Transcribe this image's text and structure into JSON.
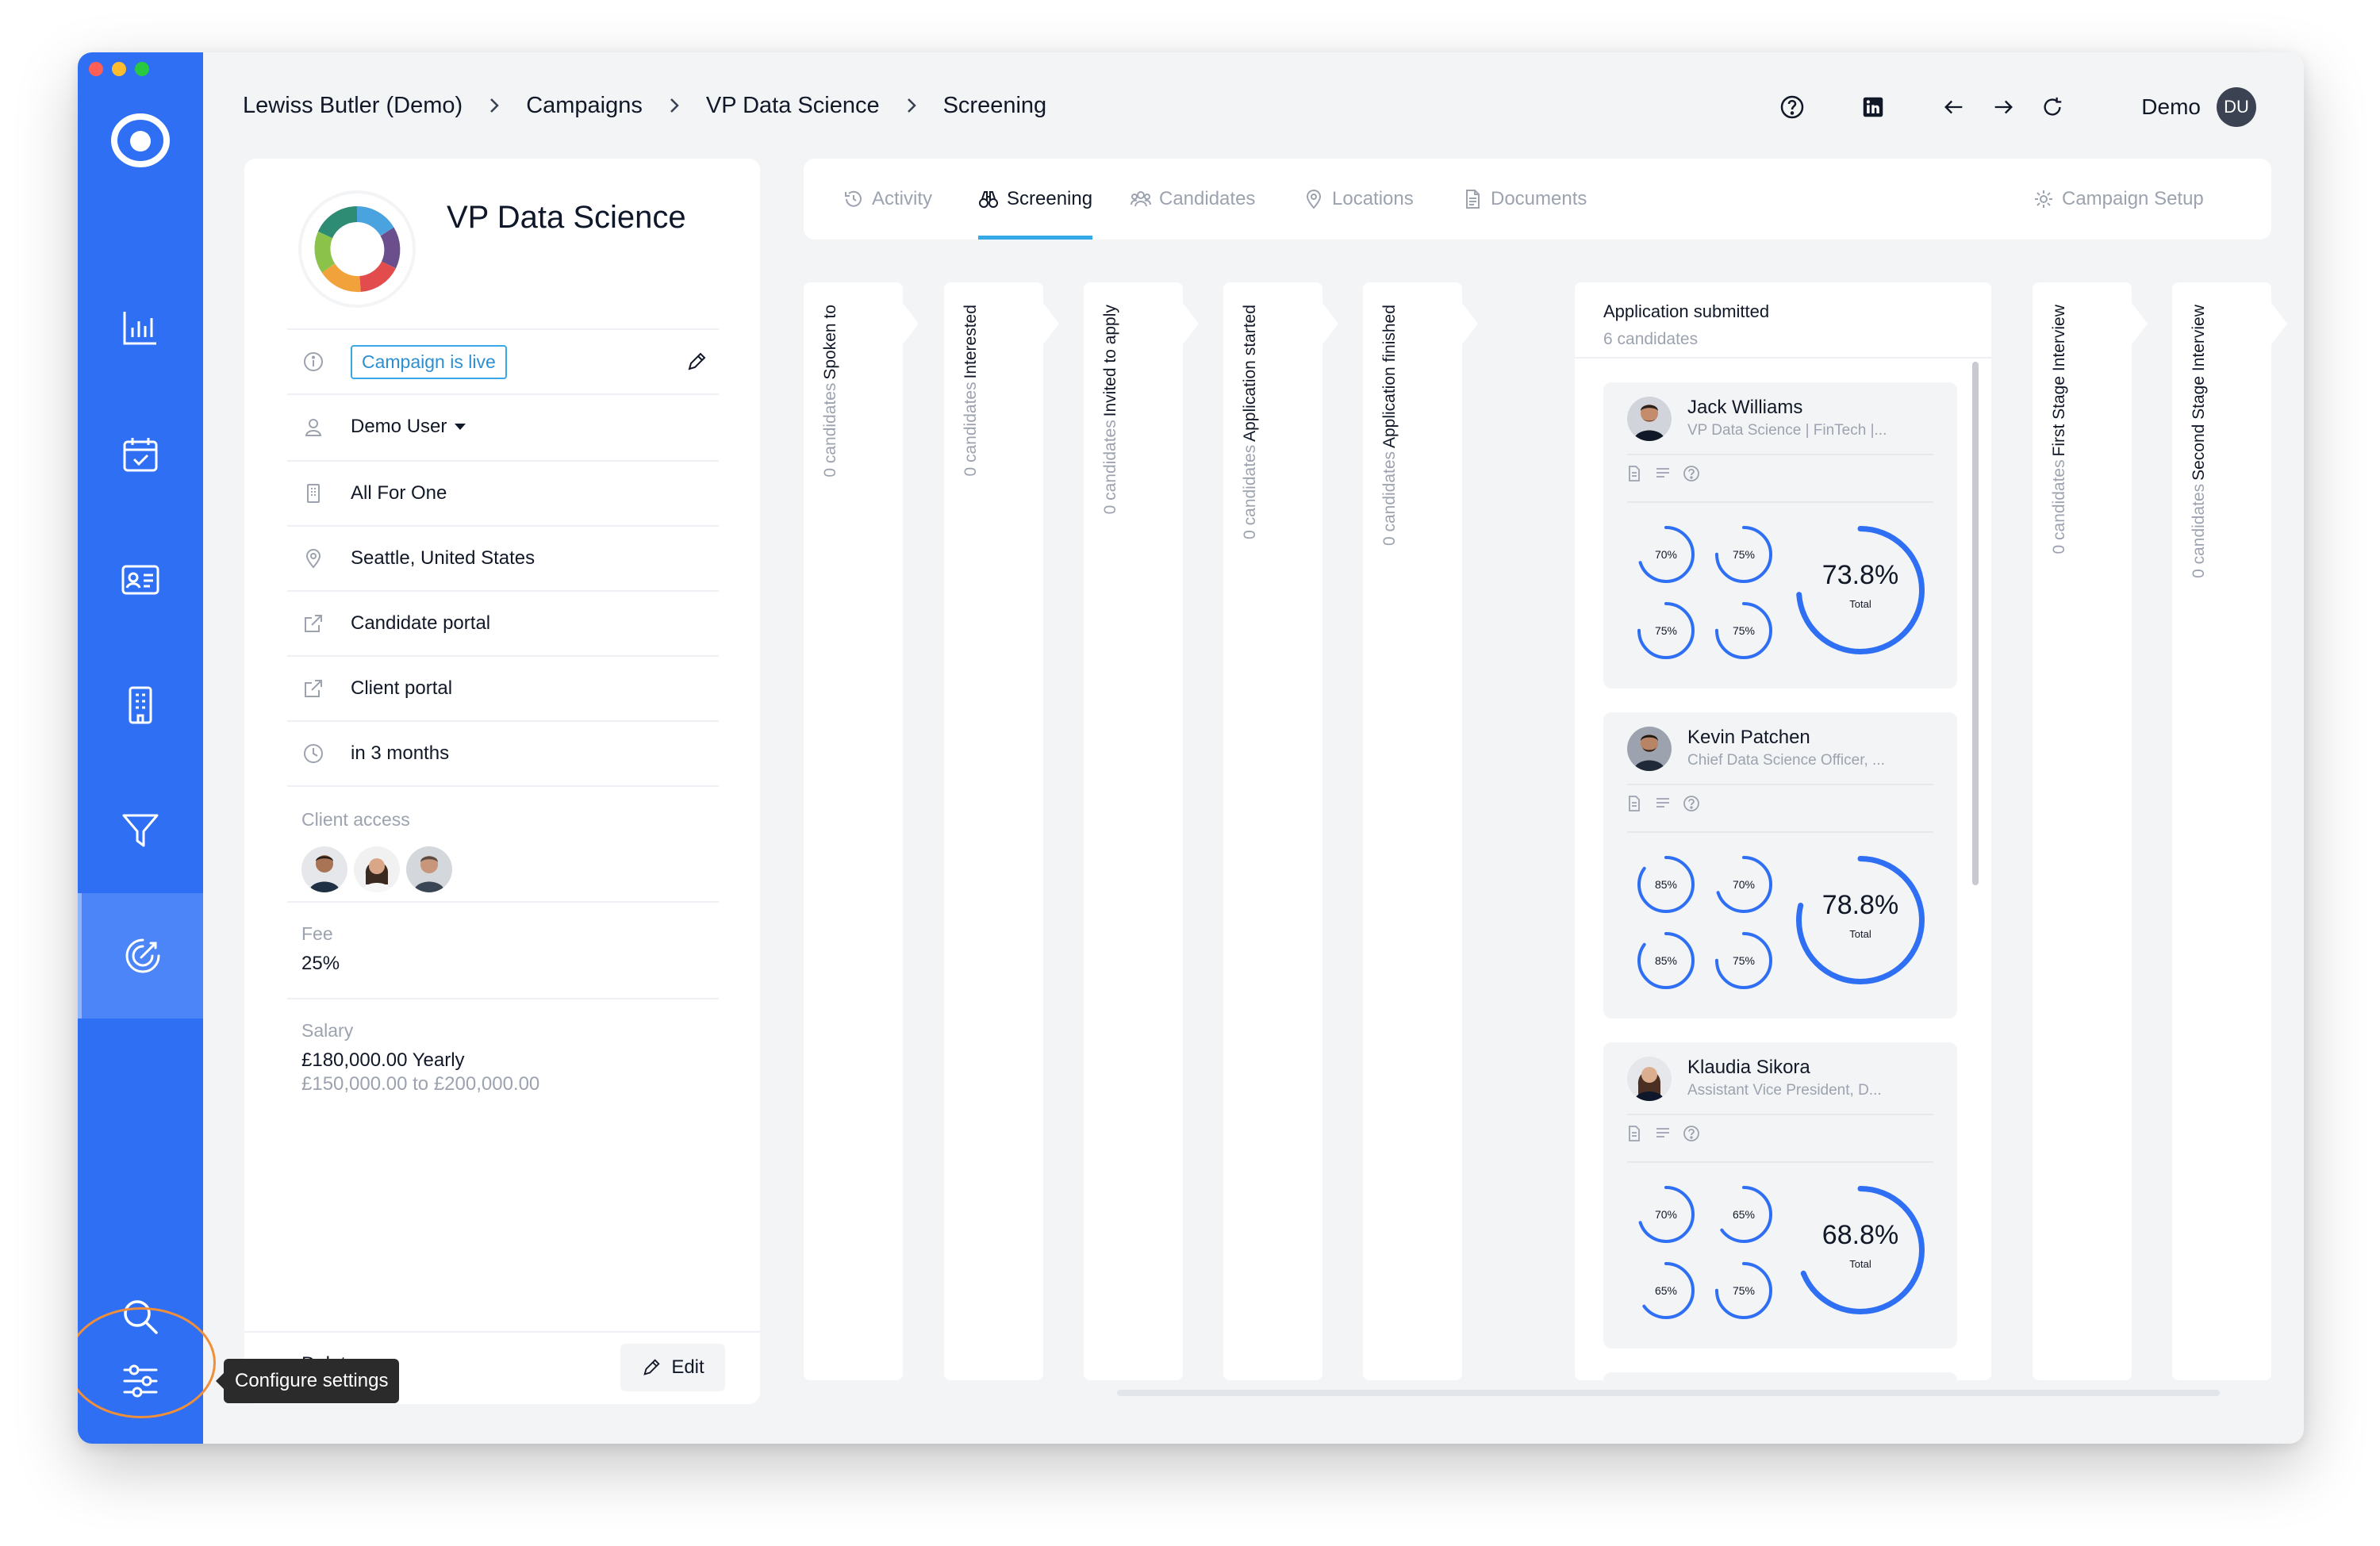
{
  "breadcrumb": [
    "Lewiss Butler (Demo)",
    "Campaigns",
    "VP Data Science",
    "Screening"
  ],
  "topbar": {
    "icons": [
      "help-circle-icon",
      "linkedin-icon",
      "arrow-left-icon",
      "arrow-right-icon",
      "refresh-icon"
    ],
    "user_label": "Demo",
    "user_initials": "DU"
  },
  "sidebar": {
    "items": [
      "dashboard-chart-icon",
      "calendar-check-icon",
      "contact-card-icon",
      "building-icon",
      "filter-icon",
      "campaign-target-icon"
    ],
    "bottom": [
      "search-icon",
      "settings-sliders-icon"
    ],
    "tooltip": "Configure settings",
    "accent": "#2f6ff4"
  },
  "campaign": {
    "title": "VP Data Science",
    "status": "Campaign is live",
    "owner": "Demo User",
    "client": "All For One",
    "location": "Seattle, United States",
    "candidate_portal": "Candidate portal",
    "client_portal": "Client portal",
    "deadline": "in 3 months",
    "client_access_label": "Client access",
    "fee_label": "Fee",
    "fee": "25%",
    "salary_label": "Salary",
    "salary": "£180,000.00 Yearly",
    "salary_range": "£150,000.00 to £200,000.00",
    "delete_label": "Delete",
    "edit_label": "Edit"
  },
  "tabs": [
    {
      "label": "Activity",
      "icon": "history-icon"
    },
    {
      "label": "Screening",
      "icon": "binoculars-icon"
    },
    {
      "label": "Candidates",
      "icon": "people-icon"
    },
    {
      "label": "Locations",
      "icon": "location-pin-icon"
    },
    {
      "label": "Documents",
      "icon": "document-icon"
    },
    {
      "label": "Campaign Setup",
      "icon": "gear-icon"
    }
  ],
  "active_tab": "Screening",
  "stages": [
    {
      "name": "Spoken to",
      "count": "0 candidates"
    },
    {
      "name": "Interested",
      "count": "0 candidates"
    },
    {
      "name": "Invited to apply",
      "count": "0 candidates"
    },
    {
      "name": "Application started",
      "count": "0 candidates"
    },
    {
      "name": "Application finished",
      "count": "0 candidates"
    },
    {
      "name": "First Stage Interview",
      "count": "0 candidates"
    },
    {
      "name": "Second Stage Interview",
      "count": "0 candidates"
    }
  ],
  "open_stage": {
    "name": "Application submitted",
    "count": "6 candidates",
    "candidates": [
      {
        "name": "Jack Williams",
        "role": "VP Data Science | FinTech |...",
        "scores": [
          70,
          75,
          75,
          75
        ],
        "total": 73.8,
        "total_label": "73.8%",
        "total_caption": "Total"
      },
      {
        "name": "Kevin Patchen",
        "role": "Chief Data Science Officer, ...",
        "scores": [
          85,
          70,
          85,
          75
        ],
        "total": 78.8,
        "total_label": "78.8%",
        "total_caption": "Total"
      },
      {
        "name": "Klaudia Sikora",
        "role": "Assistant Vice President, D...",
        "scores": [
          70,
          65,
          65,
          75
        ],
        "total": 68.8,
        "total_label": "68.8%",
        "total_caption": "Total"
      }
    ]
  },
  "ring_color": "#2f6ff4"
}
